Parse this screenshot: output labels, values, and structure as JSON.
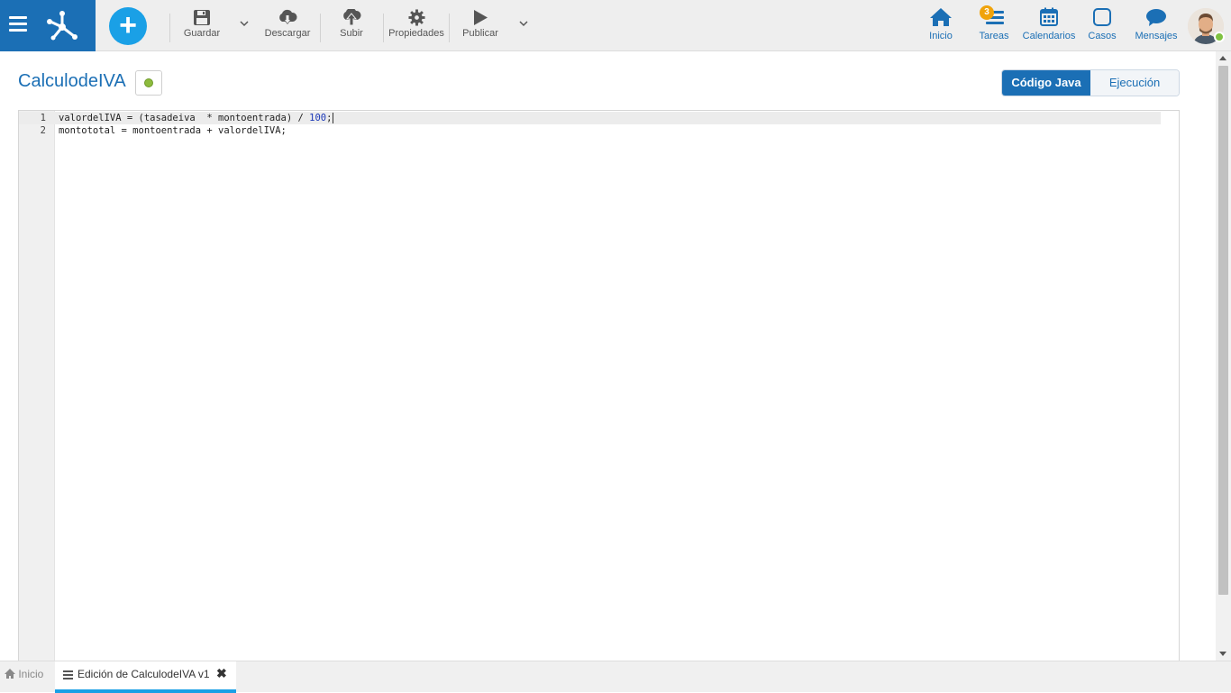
{
  "header": {
    "add_label": "+",
    "tools": {
      "save": "Guardar",
      "download": "Descargar",
      "upload": "Subir",
      "properties": "Propiedades",
      "publish": "Publicar"
    },
    "nav": {
      "home": "Inicio",
      "tasks": "Tareas",
      "tasks_badge": "3",
      "calendars": "Calendarios",
      "cases": "Casos",
      "messages": "Mensajes"
    }
  },
  "page": {
    "title": "CalculodeIVA",
    "toggle": {
      "java_code": "Código Java",
      "execution": "Ejecución"
    }
  },
  "editor": {
    "lines": [
      {
        "n": "1",
        "pre": "valordelIVA = (tasadeiva  * montoentrada) / ",
        "num": "100",
        "post": ";"
      },
      {
        "n": "2",
        "pre": "montototal = montoentrada + valordelIVA;",
        "num": "",
        "post": ""
      }
    ]
  },
  "tabs": {
    "home": "Inicio",
    "active": "Edición de CalculodeIVA v1",
    "close": "✖"
  },
  "colors": {
    "brand": "#1b6fb5",
    "accent": "#1aa0e6",
    "badge": "#f0a30a",
    "status": "#8dbb3d"
  }
}
